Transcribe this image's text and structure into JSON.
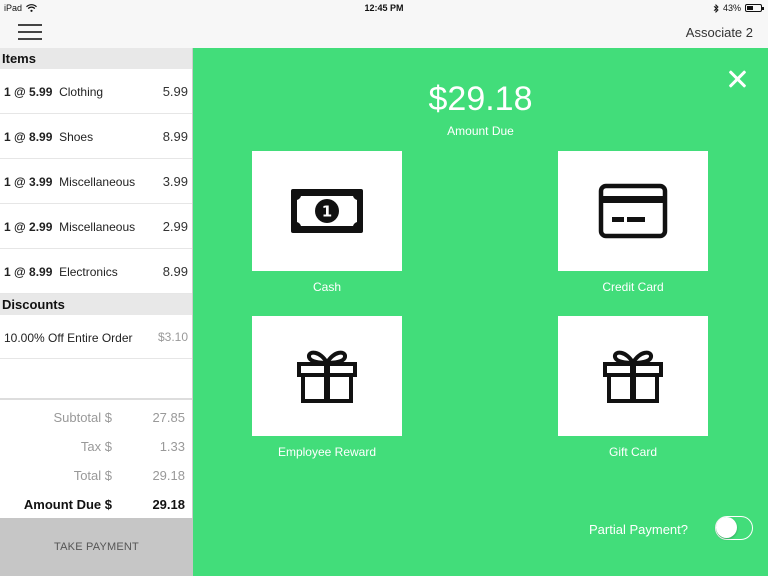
{
  "status_bar": {
    "device": "iPad",
    "time": "12:45 PM",
    "battery": "43%",
    "battery_level": 0.43
  },
  "nav": {
    "associate": "Associate 2"
  },
  "items_header": "Items",
  "items": [
    {
      "qty_price": "1 @ 5.99",
      "name": "Clothing",
      "price": "5.99"
    },
    {
      "qty_price": "1 @ 8.99",
      "name": "Shoes",
      "price": "8.99"
    },
    {
      "qty_price": "1 @ 3.99",
      "name": "Miscellaneous",
      "price": "3.99"
    },
    {
      "qty_price": "1 @ 2.99",
      "name": "Miscellaneous",
      "price": "2.99"
    },
    {
      "qty_price": "1 @ 8.99",
      "name": "Electronics",
      "price": "8.99"
    }
  ],
  "discounts_header": "Discounts",
  "discounts": [
    {
      "name": "10.00% Off Entire Order",
      "amount": "$3.10"
    }
  ],
  "totals": {
    "subtotal_label": "Subtotal $",
    "subtotal": "27.85",
    "tax_label": "Tax $",
    "tax": "1.33",
    "total_label": "Total $",
    "total": "29.18",
    "amount_due_label": "Amount Due $",
    "amount_due": "29.18"
  },
  "take_payment": "TAKE PAYMENT",
  "payment": {
    "amount": "$29.18",
    "amount_label": "Amount Due",
    "options": {
      "cash": "Cash",
      "credit_card": "Credit Card",
      "employee_reward": "Employee Reward",
      "gift_card": "Gift Card"
    },
    "partial_label": "Partial Payment?",
    "partial_enabled": false
  },
  "colors": {
    "accent_green": "#42dd7a",
    "button_gray": "#c6c6c6"
  },
  "icons": [
    "wifi-icon",
    "bluetooth-icon",
    "battery-icon",
    "hamburger-menu-icon",
    "close-icon",
    "cash-icon",
    "credit-card-icon",
    "gift-icon"
  ]
}
